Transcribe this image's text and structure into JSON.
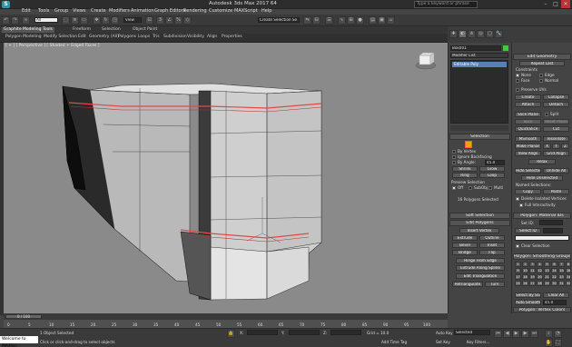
{
  "window": {
    "title": "Autodesk 3ds Max 2017  64",
    "search_placeholder": "Type a keyword or phrase",
    "minimize": "–",
    "maximize": "□",
    "close": "✕"
  },
  "menu": [
    "Edit",
    "Tools",
    "Group",
    "Views",
    "Create",
    "Modifiers",
    "Animation",
    "Graph Editors",
    "Rendering",
    "Customize",
    "MAXScript",
    "Help"
  ],
  "toolbar": {
    "filter": "All",
    "view_dropdown": "View",
    "selection_set": "Create Selection Se"
  },
  "ribbon": {
    "tabs": [
      "Graphite Modeling Tools",
      "Freeform",
      "Selection",
      "Object Paint"
    ],
    "subtabs": [
      "Polygon Modeling",
      "Modify Selection",
      "Edit",
      "Geometry (All)",
      "Polygons",
      "Loops",
      "Tris",
      "Subdivision",
      "Visibility",
      "Align",
      "Properties"
    ]
  },
  "viewport": {
    "label": "[ + ] [ Perspective ] [ Shaded + Edged Faces ]"
  },
  "command_panel": {
    "object_name": "Box001",
    "modifier_list": "Modifier List",
    "stack_item": "Editable Poly",
    "selection": {
      "title": "Selection",
      "by_vertex": "By Vertex",
      "ignore_backfacing": "Ignore Backfacing",
      "by_angle": "By Angle:",
      "angle_value": "45.0",
      "shrink": "Shrink",
      "grow": "Grow",
      "ring": "Ring",
      "loop": "Loop",
      "preview_selection": "Preview Selection",
      "off": "Off",
      "subobj": "SubObj",
      "multi": "Multi",
      "status": "16 Polygons Selected"
    },
    "soft_selection": "Soft Selection",
    "edit_polygons": {
      "title": "Edit Polygons",
      "insert_vertex": "Insert Vertex",
      "extrude": "Extrude",
      "outline": "Outline",
      "bevel": "Bevel",
      "inset": "Inset",
      "bridge": "Bridge",
      "flip": "Flip",
      "hinge": "Hinge From Edge",
      "extrude_spline": "Extrude Along Spline",
      "edit_triangulation": "Edit Triangulation",
      "retriangulate": "Retriangulate",
      "turn": "Turn"
    }
  },
  "right_panel": {
    "edit_geometry": "Edit Geometry",
    "repeat_last": "Repeat Last",
    "constraints": "Constraints",
    "none": "None",
    "edge": "Edge",
    "face": "Face",
    "normal": "Normal",
    "preserve_uvs": "Preserve UVs",
    "create": "Create",
    "collapse": "Collapse",
    "attach": "Attach",
    "detach": "Detach",
    "slice_plane": "Slice Plane",
    "split": "Split",
    "slice": "Slice",
    "reset_plane": "Reset Plane",
    "quickslice": "QuickSlice",
    "cut": "Cut",
    "msmooth": "MSmooth",
    "tessellate": "Tessellate",
    "make_planar": "Make Planar",
    "x": "X",
    "y": "Y",
    "z": "Z",
    "view_align": "View Align",
    "grid_align": "Grid Align",
    "relax": "Relax",
    "hide_selected": "Hide Selected",
    "unhide_all": "Unhide All",
    "hide_unselected": "Hide Unselected",
    "named_selections": "Named Selections:",
    "copy": "Copy",
    "paste": "Paste",
    "delete_isolated": "Delete Isolated Vertices",
    "full_interactivity": "Full Interactivity",
    "material_ids": "Polygon: Material IDs",
    "set_id": "Set ID:",
    "select_id": "Select ID",
    "clear_selection": "Clear Selection",
    "smoothing_groups": "Polygon: Smoothing Groups",
    "sg_numbers": [
      "1",
      "2",
      "3",
      "4",
      "5",
      "6",
      "7",
      "8",
      "9",
      "10",
      "11",
      "12",
      "13",
      "14",
      "15",
      "16",
      "17",
      "18",
      "19",
      "20",
      "21",
      "22",
      "23",
      "24",
      "25",
      "26",
      "27",
      "28",
      "29",
      "30",
      "31",
      "32"
    ],
    "select_by_sg": "Select By SG",
    "clear_all": "Clear All",
    "auto_smooth": "Auto Smooth",
    "auto_smooth_value": "45.0",
    "vertex_colors": "Polygon: Vertex Colors",
    "color": "Color:"
  },
  "timeline": {
    "frame": "0 / 100",
    "ticks": [
      "0",
      "5",
      "10",
      "15",
      "20",
      "25",
      "30",
      "35",
      "40",
      "45",
      "50",
      "55",
      "60",
      "65",
      "70",
      "75",
      "80",
      "85",
      "90",
      "95",
      "100"
    ]
  },
  "status": {
    "maxscript": "Welcome to MAXScr",
    "objects_selected": "1 Object Selected",
    "prompt": "Click or click-and-drag to select objects",
    "x_label": "X:",
    "y_label": "Y:",
    "z_label": "Z:",
    "grid": "Grid = 10.0",
    "auto_key": "Auto Key",
    "selected": "Selected",
    "set_key": "Set Key",
    "key_filters": "Key Filters...",
    "add_time_tag": "Add Time Tag"
  }
}
